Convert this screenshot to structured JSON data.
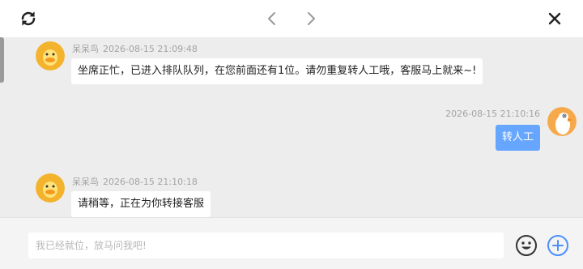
{
  "toolbar": {
    "refresh_icon": "refresh-icon",
    "prev_icon": "chevron-left-icon",
    "next_icon": "chevron-right-icon",
    "close_icon": "close-icon"
  },
  "messages": [
    {
      "side": "left",
      "sender": "呆呆鸟",
      "time": "2026-08-15 21:09:48",
      "text": "坐席正忙，已进入排队队列，在您前面还有1位。请勿重复转人工哦，客服马上就来~!"
    },
    {
      "side": "right",
      "time": "2026-08-15 21:10:16",
      "text": "转人工"
    },
    {
      "side": "left",
      "sender": "呆呆鸟",
      "time": "2026-08-15 21:10:18",
      "text": "请稍等，正在为你转接客服"
    }
  ],
  "input": {
    "placeholder": "我已经就位，放马问我吧!",
    "emoji_icon": "emoji-icon",
    "add_icon": "plus-circle-icon"
  },
  "colors": {
    "user_bubble": "#66a6ff",
    "accent_blue": "#4a90ff",
    "chat_background": "#ededed"
  }
}
